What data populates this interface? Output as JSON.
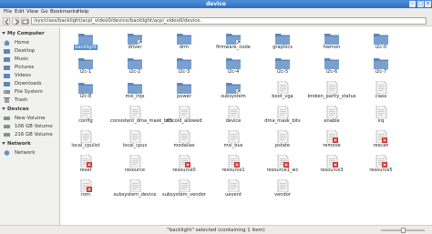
{
  "window": {
    "title": "device"
  },
  "menubar": [
    "File",
    "Edit",
    "View",
    "Go",
    "Bookmarks",
    "Help"
  ],
  "toolbar": {
    "path": "/sys/class/backlight/acpi_video0/device/backlight/acpi_video0/device."
  },
  "sidebar": {
    "sections": [
      {
        "title": "My Computer",
        "items": [
          {
            "label": "Home",
            "icon": "home-icon"
          },
          {
            "label": "Desktop",
            "icon": "desktop-icon"
          },
          {
            "label": "Music",
            "icon": "music-icon"
          },
          {
            "label": "Pictures",
            "icon": "pictures-icon"
          },
          {
            "label": "Videos",
            "icon": "videos-icon"
          },
          {
            "label": "Downloads",
            "icon": "downloads-icon"
          },
          {
            "label": "File System",
            "icon": "filesystem-icon"
          },
          {
            "label": "Trash",
            "icon": "trash-icon"
          }
        ]
      },
      {
        "title": "Devices",
        "items": [
          {
            "label": "New Volume",
            "icon": "drive-icon"
          },
          {
            "label": "106 GB Volume",
            "icon": "drive-icon"
          },
          {
            "label": "216 GB Volume",
            "icon": "drive-icon"
          }
        ]
      },
      {
        "title": "Network",
        "items": [
          {
            "label": "Network",
            "icon": "network-icon"
          }
        ]
      }
    ]
  },
  "files": [
    {
      "name": "backlight",
      "type": "folder",
      "selected": true
    },
    {
      "name": "driver",
      "type": "folder-link"
    },
    {
      "name": "drm",
      "type": "folder"
    },
    {
      "name": "firmware_node",
      "type": "folder-link"
    },
    {
      "name": "graphics",
      "type": "folder"
    },
    {
      "name": "hwmon",
      "type": "folder"
    },
    {
      "name": "i2c-0",
      "type": "folder"
    },
    {
      "name": "i2c-1",
      "type": "folder"
    },
    {
      "name": "i2c-2",
      "type": "folder"
    },
    {
      "name": "i2c-3",
      "type": "folder"
    },
    {
      "name": "i2c-4",
      "type": "folder"
    },
    {
      "name": "i2c-5",
      "type": "folder"
    },
    {
      "name": "i2c-6",
      "type": "folder"
    },
    {
      "name": "i2c-7",
      "type": "folder"
    },
    {
      "name": "i2c-8",
      "type": "folder"
    },
    {
      "name": "msi_irqs",
      "type": "folder"
    },
    {
      "name": "power",
      "type": "folder"
    },
    {
      "name": "subsystem",
      "type": "folder-link"
    },
    {
      "name": "boot_vga",
      "type": "file"
    },
    {
      "name": "broken_parity_status",
      "type": "file"
    },
    {
      "name": "class",
      "type": "file"
    },
    {
      "name": "config",
      "type": "file"
    },
    {
      "name": "consistent_dma_mask_bits",
      "type": "file"
    },
    {
      "name": "d3cold_allowed",
      "type": "file"
    },
    {
      "name": "device",
      "type": "file"
    },
    {
      "name": "dma_mask_bits",
      "type": "file"
    },
    {
      "name": "enable",
      "type": "file"
    },
    {
      "name": "irq",
      "type": "file"
    },
    {
      "name": "local_cpulist",
      "type": "file"
    },
    {
      "name": "local_cpus",
      "type": "file"
    },
    {
      "name": "modalias",
      "type": "file"
    },
    {
      "name": "msi_bus",
      "type": "file"
    },
    {
      "name": "pstate",
      "type": "file"
    },
    {
      "name": "remove",
      "type": "file-locked"
    },
    {
      "name": "rescan",
      "type": "file-locked"
    },
    {
      "name": "reset",
      "type": "file-locked"
    },
    {
      "name": "resource",
      "type": "file"
    },
    {
      "name": "resource0",
      "type": "file-locked"
    },
    {
      "name": "resource1",
      "type": "file-locked"
    },
    {
      "name": "resource1_wc",
      "type": "file-locked"
    },
    {
      "name": "resource3",
      "type": "file-locked"
    },
    {
      "name": "resource5",
      "type": "file-locked"
    },
    {
      "name": "rom",
      "type": "file-locked"
    },
    {
      "name": "subsystem_device",
      "type": "file"
    },
    {
      "name": "subsystem_vendor",
      "type": "file"
    },
    {
      "name": "uevent",
      "type": "file"
    },
    {
      "name": "vendor",
      "type": "file"
    }
  ],
  "status": {
    "text": "\"backlight\" selected (containing 1 item)"
  },
  "colors": {
    "accent": "#4a90d9",
    "folder": "#5f86b8",
    "lock": "#d22e2e"
  }
}
